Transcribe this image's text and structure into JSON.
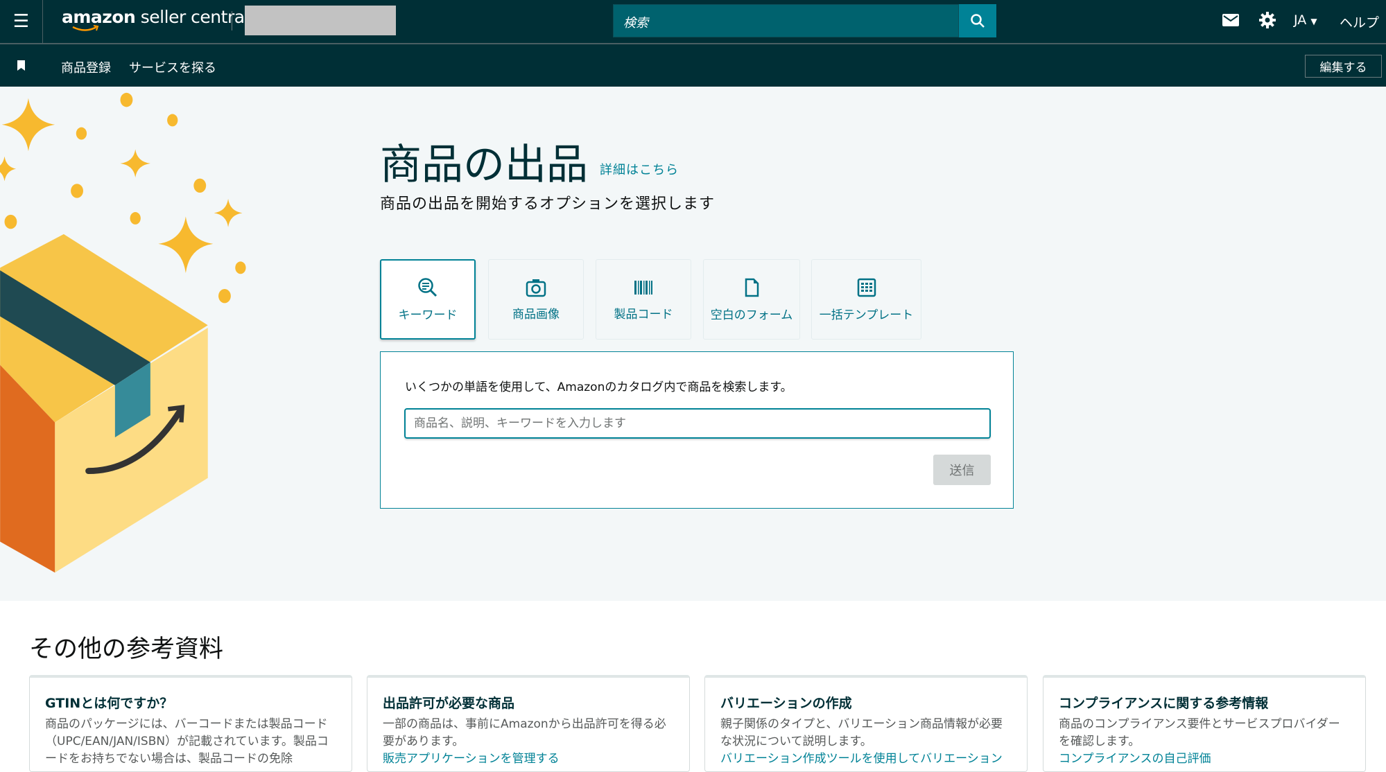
{
  "topbar": {
    "logo_bold": "amazon",
    "logo_rest": " seller central",
    "search_placeholder": "検索",
    "lang": "JA",
    "help": "ヘルプ"
  },
  "navbar": {
    "items": [
      "商品登録",
      "サービスを探る"
    ],
    "edit_label": "編集する"
  },
  "hero": {
    "title": "商品の出品",
    "learn_more": "詳細はこちら",
    "subtitle": "商品の出品を開始するオプションを選択します",
    "tabs": [
      {
        "label": "キーワード"
      },
      {
        "label": "商品画像"
      },
      {
        "label": "製品コード"
      },
      {
        "label": "空白のフォーム"
      },
      {
        "label": "一括テンプレート"
      }
    ],
    "panel": {
      "description": "いくつかの単語を使用して、Amazonのカタログ内で商品を検索します。",
      "input_placeholder": "商品名、説明、キーワードを入力します",
      "submit": "送信"
    }
  },
  "resources": {
    "title": "その他の参考資料",
    "cards": [
      {
        "title": "GTINとは何ですか？",
        "body": "商品のパッケージには、バーコードまたは製品コード（UPC/EAN/JAN/ISBN）が記載されています。製品コードをお持ちでない場合は、製品コードの免除",
        "link": ""
      },
      {
        "title": "出品許可が必要な商品",
        "body": "一部の商品は、事前にAmazonから出品許可を得る必要があります。",
        "link": "販売アプリケーションを管理する"
      },
      {
        "title": "バリエーションの作成",
        "body": "親子関係のタイプと、バリエーション商品情報が必要な状況について説明します。",
        "link": "バリエーション作成ツールを使用してバリエーション"
      },
      {
        "title": "コンプライアンスに関する参考情報",
        "body": "商品のコンプライアンス要件とサービスプロバイダーを確認します。",
        "link": "コンプライアンスの自己評価"
      }
    ]
  },
  "colors": {
    "header": "#002f36",
    "accent": "#008296",
    "hero_bg": "#f3f7f8"
  }
}
